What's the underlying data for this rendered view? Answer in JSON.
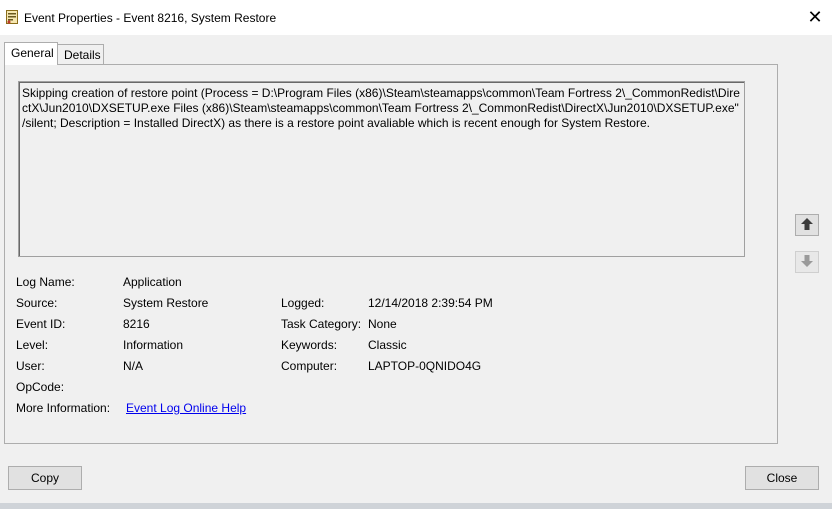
{
  "window": {
    "title": "Event Properties - Event 8216, System Restore"
  },
  "tabs": [
    {
      "label": "General",
      "active": true
    },
    {
      "label": "Details",
      "active": false
    }
  ],
  "description": "Skipping creation of restore point (Process = D:\\Program Files (x86)\\Steam\\steamapps\\common\\Team Fortress 2\\_CommonRedist\\DirectX\\Jun2010\\DXSETUP.exe Files (x86)\\Steam\\steamapps\\common\\Team Fortress 2\\_CommonRedist\\DirectX\\Jun2010\\DXSETUP.exe\" /silent; Description = Installed DirectX) as there is a restore point avaliable which is recent enough for System Restore.",
  "fields": {
    "log_name": {
      "label": "Log Name:",
      "value": "Application"
    },
    "source": {
      "label": "Source:",
      "value": "System Restore"
    },
    "event_id": {
      "label": "Event ID:",
      "value": "8216"
    },
    "level": {
      "label": "Level:",
      "value": "Information"
    },
    "user": {
      "label": "User:",
      "value": "N/A"
    },
    "opcode": {
      "label": "OpCode:",
      "value": ""
    },
    "more_info": {
      "label": "More Information:",
      "value": "Event Log Online Help"
    },
    "logged": {
      "label": "Logged:",
      "value": "12/14/2018 2:39:54 PM"
    },
    "task_category": {
      "label": "Task Category:",
      "value": "None"
    },
    "keywords": {
      "label": "Keywords:",
      "value": "Classic"
    },
    "computer": {
      "label": "Computer:",
      "value": "LAPTOP-0QNIDO4G"
    }
  },
  "buttons": {
    "copy": "Copy",
    "close": "Close"
  },
  "icons": {
    "app": "event-properties-icon",
    "up": "arrow-up-icon",
    "down": "arrow-down-icon",
    "close": "close-icon"
  },
  "colors": {
    "background": "#f0f0f0",
    "link": "#0000ee",
    "button": "#e1e1e1"
  }
}
